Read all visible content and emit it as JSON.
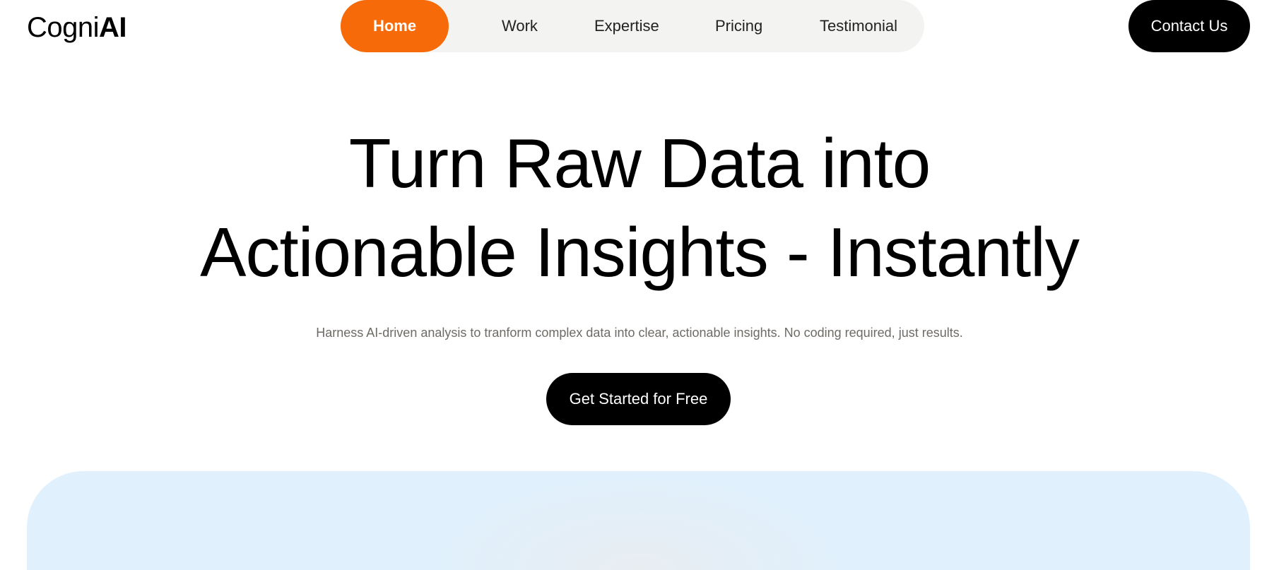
{
  "brand": {
    "name_prefix": "Cogni",
    "name_suffix": "AI"
  },
  "nav": {
    "items": [
      {
        "label": "Home",
        "active": true
      },
      {
        "label": "Work",
        "active": false
      },
      {
        "label": "Expertise",
        "active": false
      },
      {
        "label": "Pricing",
        "active": false
      },
      {
        "label": "Testimonial",
        "active": false
      }
    ],
    "active_color": "#f66a0a"
  },
  "header": {
    "contact_label": "Contact Us"
  },
  "hero": {
    "title_line1": "Turn Raw Data into",
    "title_line2": "Actionable Insights - Instantly",
    "subtitle": "Harness AI-driven analysis to tranform complex data into clear, actionable insights. No coding required, just results.",
    "cta_label": "Get Started for Free"
  },
  "colors": {
    "accent": "#f66a0a",
    "dark": "#000000",
    "nav_bg": "#f3f3f1",
    "showcase_bg": "#e0f0fc"
  }
}
